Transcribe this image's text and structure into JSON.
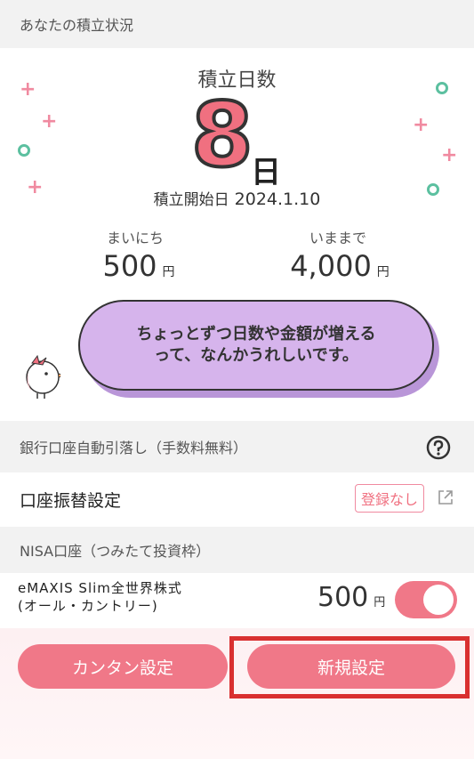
{
  "sections": {
    "status_title": "あなたの積立状況",
    "bank_title": "銀行口座自動引落し（手数料無料）",
    "nisa_title": "NISA口座（つみたて投資枠）"
  },
  "status": {
    "days_label": "積立日数",
    "days_value": "8",
    "days_unit": "日",
    "start_label": "積立開始日",
    "start_date": "2024.1.10",
    "daily_label": "まいにち",
    "daily_value": "500",
    "total_label": "いままで",
    "total_value": "4,000",
    "yen": "円",
    "message_line1": "ちょっとずつ日数や金額が増える",
    "message_line2": "って、なんかうれしいです。"
  },
  "bank": {
    "setting_label": "口座振替設定",
    "badge": "登録なし"
  },
  "fund": {
    "name_line1": "eMAXIS Slim全世界株式",
    "name_line2": "(オール・カントリー)",
    "amount": "500",
    "yen": "円",
    "toggle_on": true
  },
  "buttons": {
    "easy": "カンタン設定",
    "new": "新規設定"
  },
  "colors": {
    "accent": "#f07888",
    "bubble": "#d6b4ec",
    "highlight": "#d93030"
  }
}
